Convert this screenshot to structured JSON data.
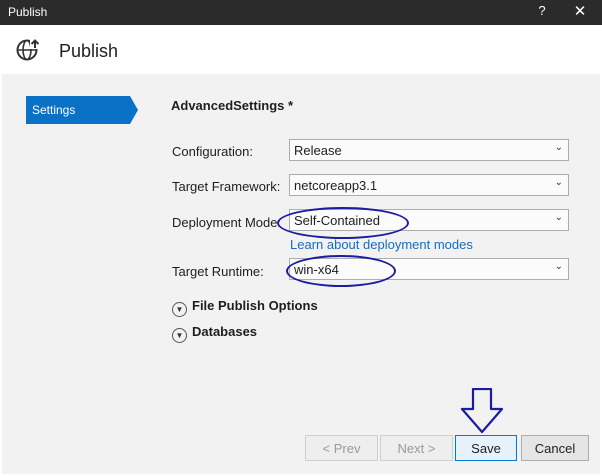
{
  "window": {
    "title": "Publish",
    "help_symbol": "?",
    "close_symbol": "✕"
  },
  "header": {
    "title": "Publish",
    "icon": "globe-publish-icon"
  },
  "sidebar": {
    "items": [
      {
        "label": "Settings",
        "selected": true
      }
    ]
  },
  "main": {
    "title": "AdvancedSettings *",
    "fields": {
      "configuration": {
        "label": "Configuration:",
        "value": "Release"
      },
      "target_framework": {
        "label": "Target Framework:",
        "value": "netcoreapp3.1"
      },
      "deployment_mode": {
        "label": "Deployment Mode:",
        "value": "Self-Contained"
      },
      "target_runtime": {
        "label": "Target Runtime:",
        "value": "win-x64"
      }
    },
    "deployment_link": "Learn about deployment modes",
    "expanders": [
      {
        "label": "File Publish Options"
      },
      {
        "label": "Databases"
      }
    ]
  },
  "footer": {
    "prev_label": "< Prev",
    "next_label": "Next >",
    "save_label": "Save",
    "cancel_label": "Cancel"
  },
  "colors": {
    "accent": "#0a72c6",
    "annotation": "#1c1ca0",
    "titlebar": "#2b2b2b"
  }
}
